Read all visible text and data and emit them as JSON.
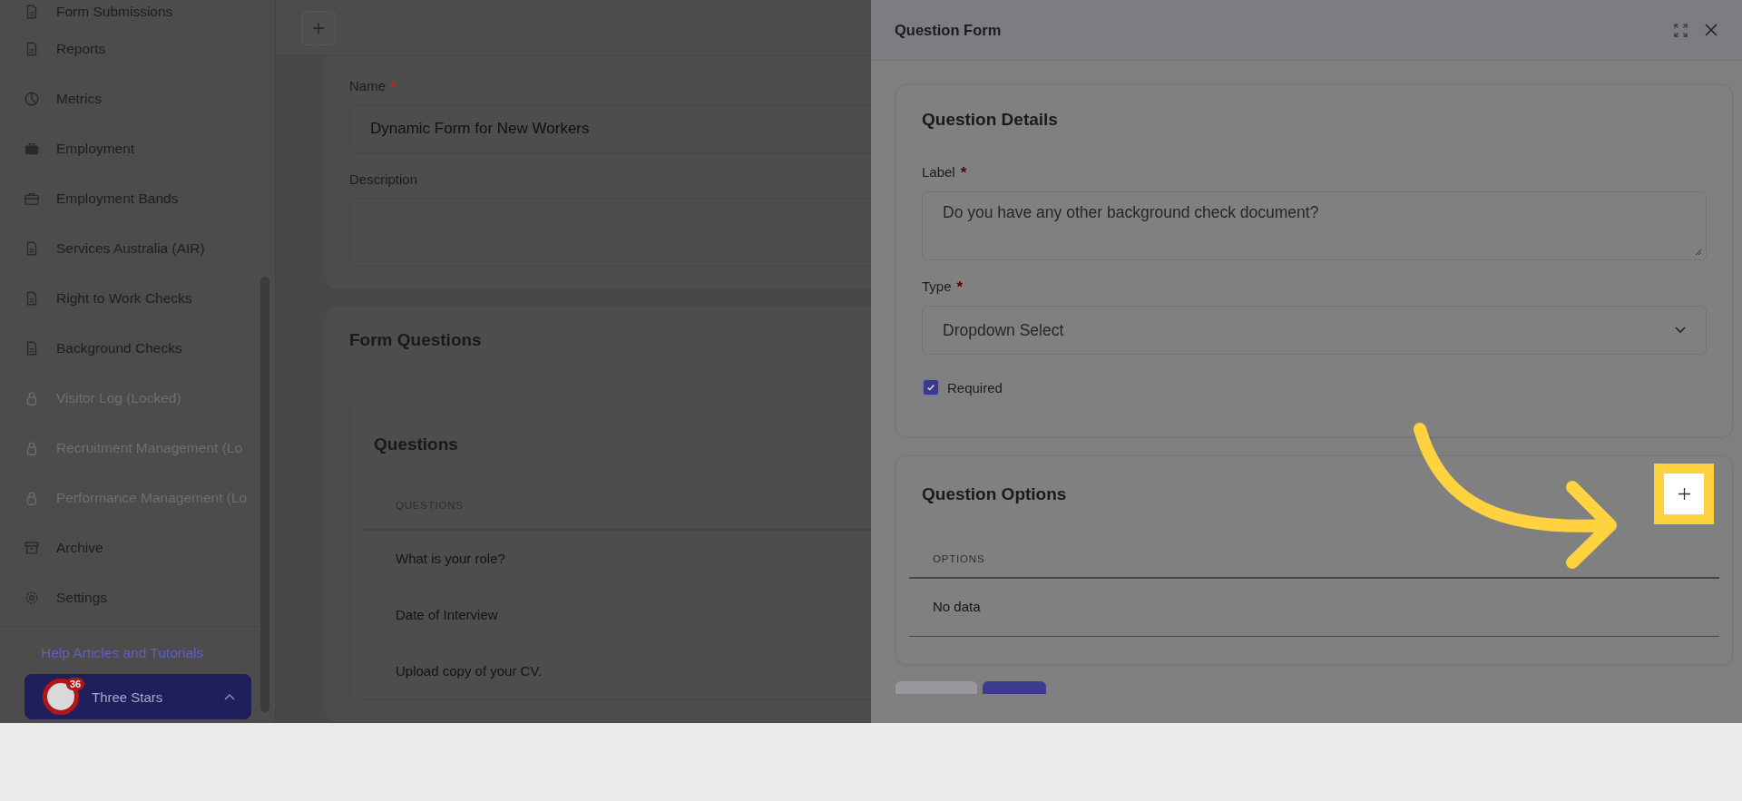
{
  "sidebar": {
    "items": [
      {
        "label": "Form Submissions",
        "locked": false
      },
      {
        "label": "Reports",
        "locked": false
      },
      {
        "label": "Metrics",
        "locked": false
      },
      {
        "label": "Employment",
        "locked": false
      },
      {
        "label": "Employment Bands",
        "locked": false
      },
      {
        "label": "Services Australia (AIR)",
        "locked": false
      },
      {
        "label": "Right to Work Checks",
        "locked": false
      },
      {
        "label": "Background Checks",
        "locked": false
      },
      {
        "label": "Visitor Log (Locked)",
        "locked": true
      },
      {
        "label": "Recruitment Management (Lo",
        "locked": true
      },
      {
        "label": "Performance Management (Lo",
        "locked": true
      },
      {
        "label": "Archive",
        "locked": false
      },
      {
        "label": "Settings",
        "locked": false
      }
    ],
    "help_link": "Help Articles and Tutorials",
    "account": {
      "badge": "36",
      "name": "Three Stars"
    }
  },
  "form": {
    "name": {
      "label": "Name",
      "mark": "*",
      "value": "Dynamic Form for New Workers"
    },
    "description": {
      "label": "Description"
    }
  },
  "form_questions": {
    "title": "Form Questions",
    "table_title": "Questions",
    "column": "QUESTIONS",
    "rows": [
      "What is your role?",
      "Date of Interview",
      "Upload copy of your CV."
    ]
  },
  "drawer": {
    "title": "Question Form",
    "details_title": "Question Details",
    "label_field": {
      "label": "Label",
      "mark": "*",
      "value": "Do you have any other background check document?"
    },
    "type_field": {
      "label": "Type",
      "mark": "*",
      "value": "Dropdown Select"
    },
    "required": {
      "label": "Required",
      "checked": true
    },
    "options_title": "Question Options",
    "options_column": "OPTIONS",
    "empty_text": "No data"
  }
}
